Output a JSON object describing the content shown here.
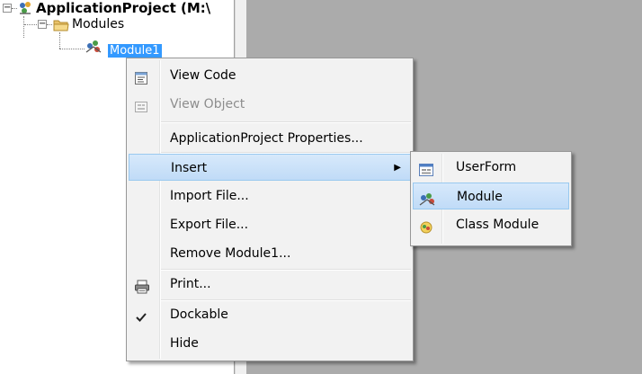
{
  "tree": {
    "root_label": "ApplicationProject (M:\\",
    "modules_label": "Modules",
    "module1_label": "Module1"
  },
  "context_menu": {
    "items": [
      {
        "label": "View Code",
        "icon": "view-code-icon",
        "enabled": true
      },
      {
        "label": "View Object",
        "icon": "view-object-icon",
        "enabled": false
      },
      {
        "label": "ApplicationProject Properties...",
        "enabled": true
      },
      {
        "label": "Insert",
        "enabled": true,
        "submenu": true,
        "highlighted": true
      },
      {
        "label": "Import File...",
        "enabled": true
      },
      {
        "label": "Export File...",
        "enabled": true
      },
      {
        "label": "Remove Module1...",
        "enabled": true
      },
      {
        "label": "Print...",
        "icon": "printer-icon",
        "enabled": true
      },
      {
        "label": "Dockable",
        "icon": "checkmark-icon",
        "checked": true,
        "enabled": true
      },
      {
        "label": "Hide",
        "enabled": true
      }
    ]
  },
  "insert_submenu": {
    "items": [
      {
        "label": "UserForm",
        "icon": "userform-icon"
      },
      {
        "label": "Module",
        "icon": "module-icon",
        "highlighted": true
      },
      {
        "label": "Class Module",
        "icon": "class-module-icon"
      }
    ]
  },
  "colors": {
    "selection": "#3399ff",
    "menu_highlight": "#cce4f7",
    "workspace": "#ababab"
  }
}
